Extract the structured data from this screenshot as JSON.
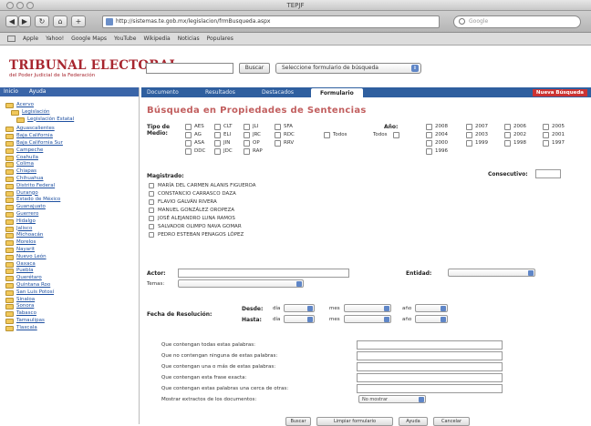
{
  "browser": {
    "window_title": "TEPJF",
    "url": "http://sistemas.te.gob.mx/legislacion/frmBusqueda.aspx",
    "search_placeholder": "Google",
    "bookmarks": [
      "Apple",
      "Yahoo!",
      "Google Maps",
      "YouTube",
      "Wikipedia",
      "Noticias",
      "Populares"
    ]
  },
  "site": {
    "logo_title": "TRIBUNAL ELECTORAL",
    "logo_subtitle": "del Poder Judicial de la Federación",
    "search_button": "Buscar",
    "select_value": "Seleccione formulario de búsqueda"
  },
  "leftnav": {
    "tabs": [
      "Inicio",
      "Ayuda"
    ],
    "root": "Acervo",
    "sub": "Legislación",
    "subsub": "Legislación Estatal",
    "states": [
      "Aguascalientes",
      "Baja California",
      "Baja California Sur",
      "Campeche",
      "Coahuila",
      "Colima",
      "Chiapas",
      "Chihuahua",
      "Distrito Federal",
      "Durango",
      "Estado de México",
      "Guanajuato",
      "Guerrero",
      "Hidalgo",
      "Jalisco",
      "Michoacán",
      "Morelos",
      "Nayarit",
      "Nuevo León",
      "Oaxaca",
      "Puebla",
      "Querétaro",
      "Quintana Roo",
      "San Luis Potosí",
      "Sinaloa",
      "Sonora",
      "Tabasco",
      "Tamaulipas",
      "Tlaxcala"
    ]
  },
  "tabs": {
    "items": [
      "Documento",
      "Resultados",
      "Destacados",
      "Formulario"
    ],
    "right_button": "Nueva Búsqueda"
  },
  "form": {
    "heading": "Búsqueda en Propiedades de Sentencias",
    "tipo_label": "Tipo de Medio:",
    "medios_row1": [
      "AES",
      "CLT",
      "JLI",
      "SFA"
    ],
    "medios_row2": [
      "AG",
      "ELI",
      "JRC",
      "RDC"
    ],
    "medios_row3": [
      "ASA",
      "JIN",
      "OP",
      "RRV"
    ],
    "medios_row4": [
      "DDC",
      "JDC",
      "RAP"
    ],
    "todos_label": "Todos",
    "anio_label": "Año:",
    "anio_todos": "Todos",
    "years_col1": [
      "2008",
      "2004",
      "2000",
      "1996"
    ],
    "years_col2": [
      "2007",
      "2003",
      "1999"
    ],
    "years_col3": [
      "2006",
      "2002",
      "1998"
    ],
    "years_col4": [
      "2005",
      "2001",
      "1997"
    ],
    "magistrado_label": "Magistrado:",
    "consecutivo_label": "Consecutivo:",
    "magistrados": [
      "MARÍA DEL CARMEN ALANIS FIGUEROA",
      "CONSTANCIO CARRASCO DAZA",
      "FLAVIO GALVÁN RIVERA",
      "MANUEL GONZÁLEZ OROPEZA",
      "JOSÉ ALEJANDRO LUNA RAMOS",
      "SALVADOR OLIMPO NAVA GOMAR",
      "PEDRO ESTEBAN PENAGOS LÓPEZ"
    ],
    "actor_label": "Actor:",
    "entidad_label": "Entidad:",
    "tema_label": "Temas:",
    "fecha_label": "Fecha de Resolución:",
    "desde_label": "Desde:",
    "hasta_label": "Hasta:",
    "dia_label": "día",
    "mes_label": "mes",
    "anio_small": "año",
    "text_rows": [
      "Que contengan todas estas palabras:",
      "Que no contengan ninguna de estas palabras:",
      "Que contengan una o más de estas palabras:",
      "Que contengan esta frase exacta:",
      "Que contengan estas palabras una cerca de otras:",
      "Mostrar extractos de los documentos:"
    ],
    "extract_value": "No mostrar",
    "buttons": [
      "Buscar",
      "Limpiar formulario",
      "Ayuda",
      "Cancelar"
    ]
  }
}
